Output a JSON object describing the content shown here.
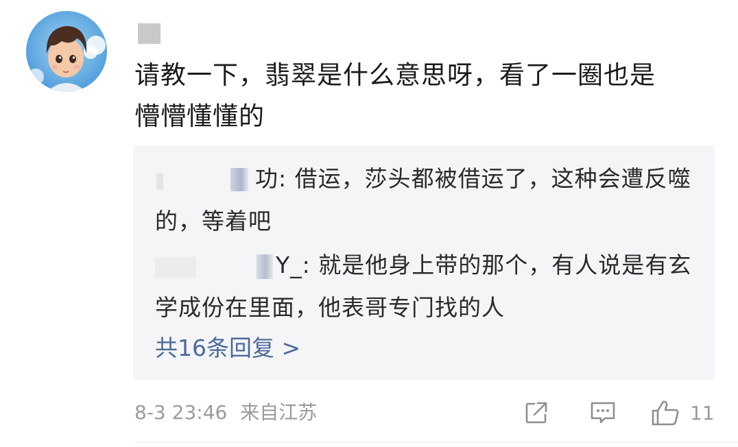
{
  "comment": {
    "text_line1": "请教一下，翡翠是什么意思呀，看了一圈也是",
    "text_line2": "懵懵懂懂的"
  },
  "replies": [
    {
      "author_suffix": "功: ",
      "text": "借运，莎头都被借运了，这种会遭反噬的，等着吧"
    },
    {
      "author_suffix": "Y_: ",
      "text": "就是他身上带的那个，有人说是有玄学成份在里面，他表哥专门找的人"
    }
  ],
  "more_replies_label": "共16条回复 >",
  "footer": {
    "timestamp": "8-3 23:46",
    "location": "来自江苏"
  },
  "actions": {
    "like_count": "11"
  },
  "icons": {
    "share": "share-icon",
    "comment": "comment-icon",
    "like": "thumbs-up-icon"
  },
  "colors": {
    "link": "#4b6a98",
    "muted": "#9a9a9a",
    "reply_bg": "#f5f5f7"
  }
}
